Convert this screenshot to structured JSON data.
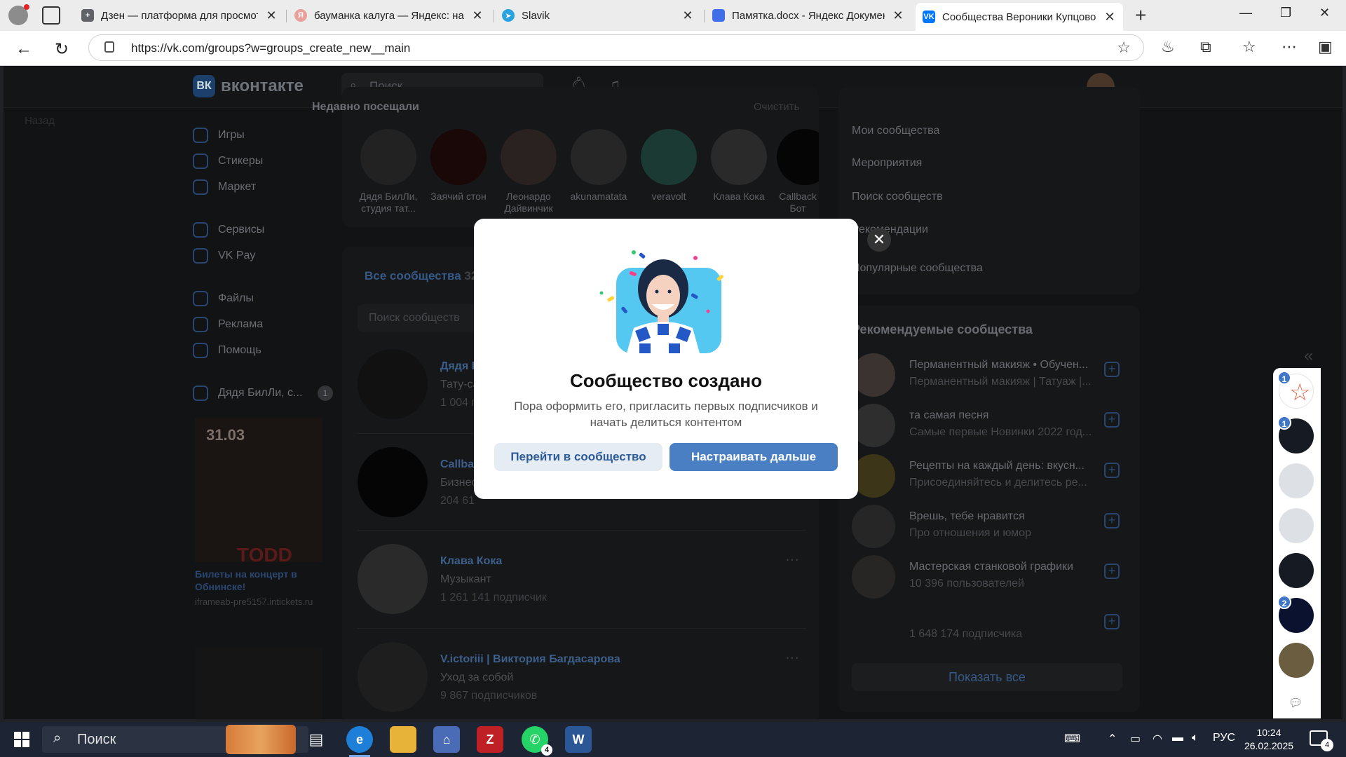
{
  "browser": {
    "tabs": [
      {
        "title": "Дзен — платформа для просмот",
        "favicon_color": "#5f6368"
      },
      {
        "title": "бауманка калуга — Яндекс: наш",
        "favicon_color": "#e8a09a"
      },
      {
        "title": "Slavik",
        "favicon_color": "#2aa3e0"
      },
      {
        "title": "Памятка.docx - Яндекс Докумен",
        "favicon_color": "#3f6ee8"
      },
      {
        "title": "Сообщества Вероники Купцово",
        "favicon_color": "#0077ff"
      }
    ],
    "url": "https://vk.com/groups?w=groups_create_new__main"
  },
  "vk": {
    "logo_text": "ВК",
    "brand": "вконтакте",
    "search_placeholder": "Поиск",
    "back_link": "Назад",
    "menu": [
      {
        "label": "Игры"
      },
      {
        "label": "Стикеры"
      },
      {
        "label": "Маркет"
      },
      {
        "label": "Сервисы"
      },
      {
        "label": "VK Pay"
      },
      {
        "label": "Файлы"
      },
      {
        "label": "Реклама"
      },
      {
        "label": "Помощь"
      },
      {
        "label": "Дядя БилЛи, с...",
        "count": "1"
      }
    ],
    "promo": {
      "date": "31.03",
      "poster_text": "TODD",
      "title": "Билеты на концерт в Обнинске!",
      "source": "iframeab-pre5157.intickets.ru"
    },
    "recent": {
      "title": "Недавно посещали",
      "clear": "Очистить",
      "items": [
        {
          "name": "Дядя БилЛи, студия тат..."
        },
        {
          "name": "Заячий стон"
        },
        {
          "name": "Леонардо Дайвинчик"
        },
        {
          "name": "akunamatata"
        },
        {
          "name": "veravolt"
        },
        {
          "name": "Клава Кока"
        },
        {
          "name": "Callback Бот"
        }
      ]
    },
    "communities": {
      "tab": "Все сообщества",
      "count": "32",
      "search_placeholder": "Поиск сообществ",
      "items": [
        {
          "name": "Дядя Б",
          "desc": "Тату-са",
          "subs": "1 004 п"
        },
        {
          "name": "Callbac",
          "desc": "Бизнес",
          "subs": "204 61"
        },
        {
          "name": "Клава Кока",
          "desc": "Музыкант",
          "subs": "1 261 141 подписчик"
        },
        {
          "name": "V.ictoriii | Виктория Багдасарова",
          "desc": "Уход за собой",
          "subs": "9 867 подписчиков"
        }
      ]
    },
    "right_menu": [
      "Мои сообщества",
      "Мероприятия",
      "Поиск сообществ",
      "Рекомендации",
      "Популярные сообщества"
    ],
    "recommended": {
      "title": "Рекомендуемые сообщества",
      "items": [
        {
          "name": "Перманентный макияж • Обучен...",
          "desc": "Перманентный макияж | Татуаж |..."
        },
        {
          "name": "та самая песня",
          "desc": "Самые первые Новинки 2022 год..."
        },
        {
          "name": "Рецепты на каждый день: вкусн...",
          "desc": "Присоединяйтесь и делитесь ре..."
        },
        {
          "name": "Врешь, тебе нравится",
          "desc": "Про отношения и юмор"
        },
        {
          "name": "Мастерская станковой графики",
          "desc": "10 396 пользователей"
        },
        {
          "name": "",
          "desc": "1 648 174 подписчика"
        }
      ],
      "show_all": "Показать все"
    },
    "chat_rail": {
      "badges": [
        "1",
        "1",
        "2"
      ]
    }
  },
  "modal": {
    "title": "Сообщество создано",
    "text": "Пора оформить его, пригласить первых подписчиков и начать делиться контентом",
    "btn_secondary": "Перейти в сообщество",
    "btn_primary": "Настраивать дальше",
    "close_icon": "close-icon"
  },
  "taskbar": {
    "search_placeholder": "Поиск",
    "apps": [
      {
        "name": "edge",
        "color": "#1e7fd8"
      },
      {
        "name": "explorer",
        "color": "#e8b339"
      },
      {
        "name": "network",
        "color": "#4a6bb5"
      },
      {
        "name": "filezilla",
        "color": "#bf2026",
        "label": "Z"
      },
      {
        "name": "whatsapp",
        "color": "#25d366",
        "badge": "4"
      },
      {
        "name": "word",
        "color": "#2b5797",
        "label": "W"
      }
    ],
    "lang": "РУС",
    "time": "10:24",
    "date": "26.02.2025",
    "notifications": "4"
  }
}
